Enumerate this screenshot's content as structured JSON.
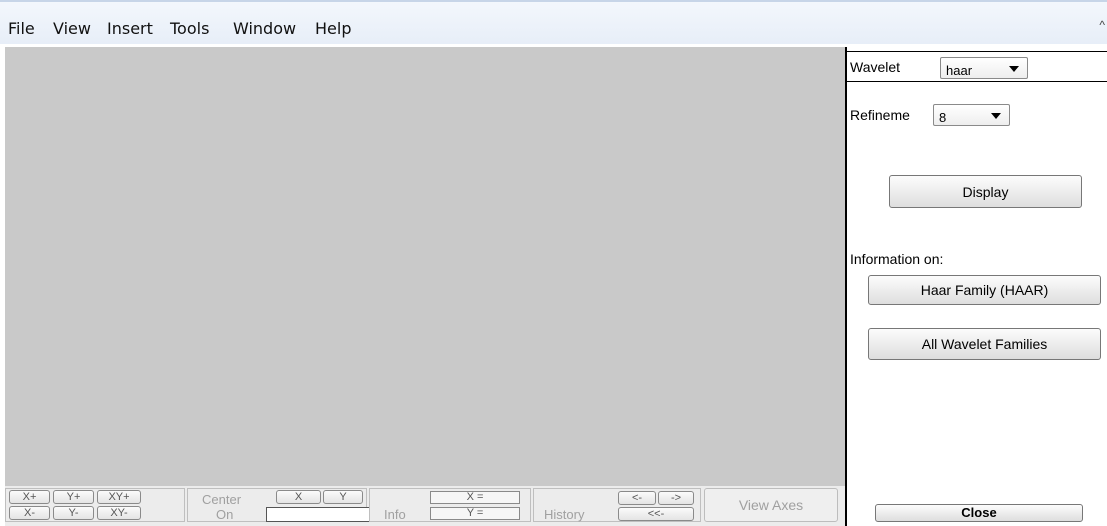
{
  "menu": {
    "items": [
      "File",
      "View",
      "Insert",
      "Tools",
      "Window",
      "Help"
    ],
    "corner": "^"
  },
  "bottom_bar": {
    "axis_buttons": {
      "x_plus": "X+",
      "y_plus": "Y+",
      "xy_plus": "XY+",
      "x_minus": "X-",
      "y_minus": "Y-",
      "xy_minus": "XY-"
    },
    "center_on": {
      "label_line1": "Center",
      "label_line2": "On",
      "x_button": "X",
      "y_button": "Y",
      "value": ""
    },
    "info": {
      "label": "Info",
      "x_field": "X =",
      "y_field": "Y ="
    },
    "history": {
      "label": "History",
      "back": "<-",
      "forward": "->",
      "first": "<<-"
    },
    "view_axes": "View Axes"
  },
  "side_panel": {
    "wavelet_label": "Wavelet",
    "wavelet_value": "haar",
    "refinement_label": "Refineme",
    "refinement_value": "8",
    "display_button": "Display",
    "information_label": "Information on:",
    "family_button": "Haar Family (HAAR)",
    "all_families_button": "All Wavelet Families",
    "close_button": "Close"
  }
}
